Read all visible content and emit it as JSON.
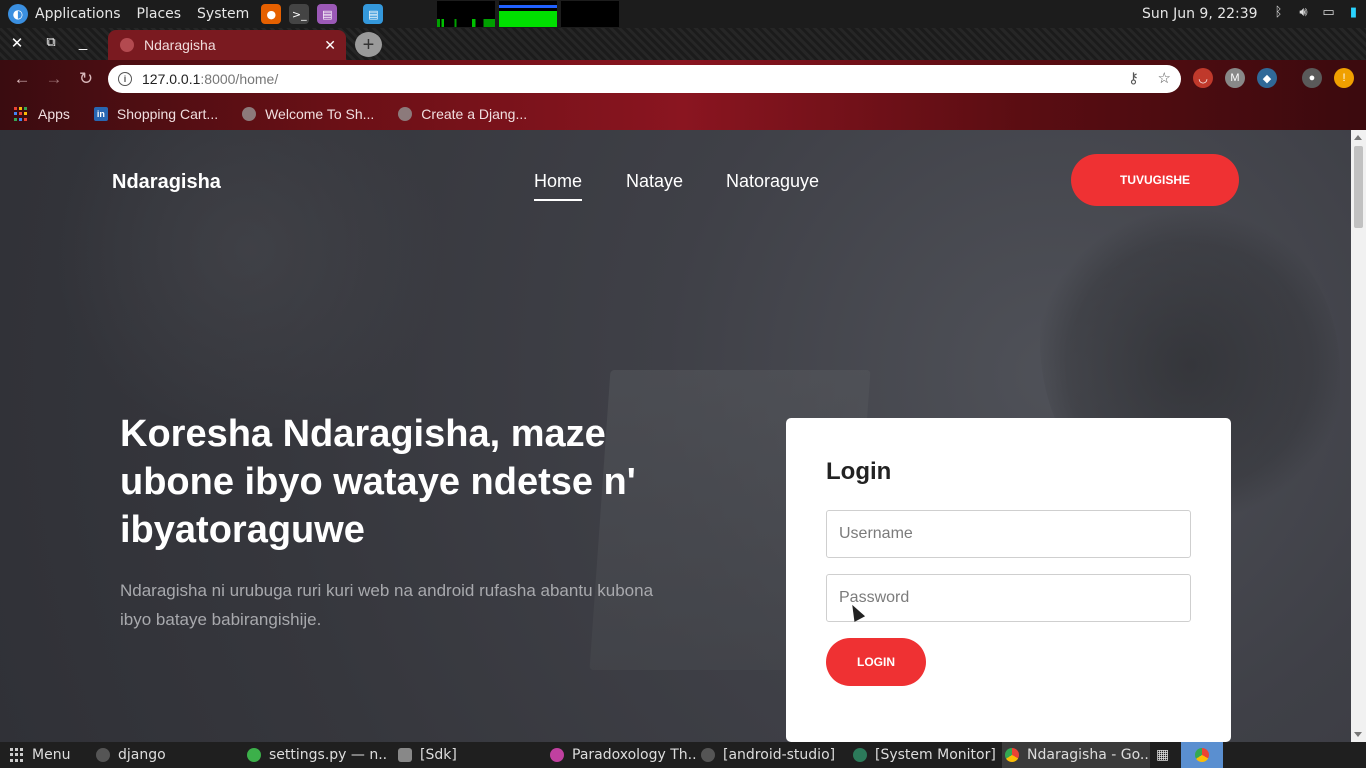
{
  "system_bar": {
    "menus": [
      "Applications",
      "Places",
      "System"
    ],
    "clock": "Sun Jun 9, 22:39",
    "launchers": [
      "firefox-icon",
      "terminal-icon",
      "text-editor-icon",
      "notes-icon"
    ],
    "tray_icons": [
      "bluetooth-icon",
      "volume-icon",
      "screen-icon",
      "battery-icon"
    ]
  },
  "browser": {
    "tab": {
      "title": "Ndaragisha"
    },
    "url": {
      "host": "127.0.0.1",
      "path": ":8000/home/"
    },
    "bookmarks": [
      {
        "label": "Apps",
        "icon": "apps-grid-icon"
      },
      {
        "label": "Shopping Cart...",
        "icon": "linkedin-icon"
      },
      {
        "label": "Welcome To Sh...",
        "icon": "globe-icon"
      },
      {
        "label": "Create a Djang...",
        "icon": "globe-icon"
      }
    ],
    "extensions": [
      "pocket-icon",
      "gmail-icon",
      "python-icon",
      "avatar-icon",
      "update-icon"
    ],
    "colors": {
      "frame": "#8a1520",
      "tab": "#7a1a20"
    }
  },
  "site": {
    "brand": "Ndaragisha",
    "nav": [
      {
        "label": "Home",
        "active": true
      },
      {
        "label": "Nataye",
        "active": false
      },
      {
        "label": "Natoraguye",
        "active": false
      }
    ],
    "cta_label": "TUVUGISHE",
    "hero": {
      "title": "Koresha Ndaragisha, maze ubone ibyo wataye ndetse n' ibyatoraguwe",
      "subtitle": "Ndaragisha ni urubuga ruri kuri web na android rufasha abantu kubona ibyo bataye babirangishije."
    },
    "login": {
      "title": "Login",
      "username_placeholder": "Username",
      "password_placeholder": "Password",
      "button_label": "LOGIN"
    },
    "colors": {
      "accent": "#ef3133",
      "card": "#ffffff"
    }
  },
  "taskbar": {
    "menu_label": "Menu",
    "tasks": [
      {
        "label": "django",
        "icon": "terminal-icon"
      },
      {
        "label": "settings.py — n...",
        "icon": "editor-icon"
      },
      {
        "label": "[Sdk]",
        "icon": "folder-icon"
      },
      {
        "label": "Paradoxology Th...",
        "icon": "media-player-icon"
      },
      {
        "label": "[android-studio]",
        "icon": "terminal-icon"
      },
      {
        "label": "[System Monitor]",
        "icon": "system-monitor-icon"
      },
      {
        "label": "Ndaragisha - Go...",
        "icon": "chrome-icon",
        "active": true
      }
    ]
  }
}
